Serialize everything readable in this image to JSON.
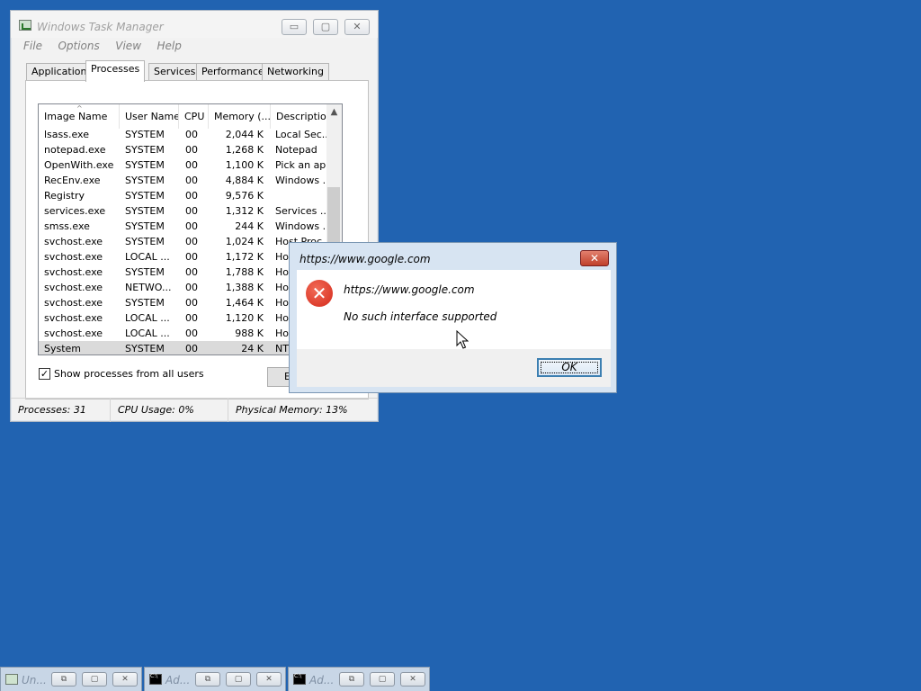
{
  "taskmgr": {
    "title": "Windows Task Manager",
    "caption_buttons": {
      "minimize": "▭",
      "restore": "▢",
      "close": "✕"
    },
    "menu": [
      "File",
      "Options",
      "View",
      "Help"
    ],
    "tabs": [
      "Applications",
      "Processes",
      "Services",
      "Performance",
      "Networking"
    ],
    "active_tab": "Processes",
    "columns": [
      "Image Name",
      "User Name",
      "CPU",
      "Memory (...",
      "Description"
    ],
    "rows": [
      {
        "name": "lsass.exe",
        "user": "SYSTEM",
        "cpu": "00",
        "mem": "2,044 K",
        "desc": "Local Sec..."
      },
      {
        "name": "notepad.exe",
        "user": "SYSTEM",
        "cpu": "00",
        "mem": "1,268 K",
        "desc": "Notepad"
      },
      {
        "name": "OpenWith.exe",
        "user": "SYSTEM",
        "cpu": "00",
        "mem": "1,100 K",
        "desc": "Pick an app"
      },
      {
        "name": "RecEnv.exe",
        "user": "SYSTEM",
        "cpu": "00",
        "mem": "4,884 K",
        "desc": "Windows ..."
      },
      {
        "name": "Registry",
        "user": "SYSTEM",
        "cpu": "00",
        "mem": "9,576 K",
        "desc": ""
      },
      {
        "name": "services.exe",
        "user": "SYSTEM",
        "cpu": "00",
        "mem": "1,312 K",
        "desc": "Services ..."
      },
      {
        "name": "smss.exe",
        "user": "SYSTEM",
        "cpu": "00",
        "mem": "244 K",
        "desc": "Windows ..."
      },
      {
        "name": "svchost.exe",
        "user": "SYSTEM",
        "cpu": "00",
        "mem": "1,024 K",
        "desc": "Host Proc..."
      },
      {
        "name": "svchost.exe",
        "user": "LOCAL ...",
        "cpu": "00",
        "mem": "1,172 K",
        "desc": "Host"
      },
      {
        "name": "svchost.exe",
        "user": "SYSTEM",
        "cpu": "00",
        "mem": "1,788 K",
        "desc": "Host"
      },
      {
        "name": "svchost.exe",
        "user": "NETWO...",
        "cpu": "00",
        "mem": "1,388 K",
        "desc": "Host"
      },
      {
        "name": "svchost.exe",
        "user": "SYSTEM",
        "cpu": "00",
        "mem": "1,464 K",
        "desc": "Host"
      },
      {
        "name": "svchost.exe",
        "user": "LOCAL ...",
        "cpu": "00",
        "mem": "1,120 K",
        "desc": "Host"
      },
      {
        "name": "svchost.exe",
        "user": "LOCAL ...",
        "cpu": "00",
        "mem": "988 K",
        "desc": "Host"
      },
      {
        "name": "System",
        "user": "SYSTEM",
        "cpu": "00",
        "mem": "24 K",
        "desc": "NT"
      }
    ],
    "selected_row": 14,
    "show_all_users": {
      "label": "Show processes from all users",
      "checked": true,
      "mark": "✓"
    },
    "end_button": "End Process",
    "status": {
      "processes": "Processes: 31",
      "cpu": "CPU Usage: 0%",
      "memory": "Physical Memory: 13%"
    }
  },
  "dialog": {
    "title": "https://www.google.com",
    "close_glyph": "✕",
    "icon_glyph": "✕",
    "message_title": "https://www.google.com",
    "message": "No such interface supported",
    "ok_label": "OK"
  },
  "minimized": [
    {
      "label": "Un...",
      "icon": "task-manager-icon"
    },
    {
      "label": "Ad...",
      "icon": "command-prompt-icon"
    },
    {
      "label": "Ad...",
      "icon": "command-prompt-icon"
    }
  ],
  "mini_buttons": {
    "restore": "⧉",
    "maximize": "▢",
    "close": "✕"
  },
  "colors": {
    "desktop": "#2163b1",
    "error_icon": "#d4291a",
    "dialog_close": "#c0402b",
    "selected_row": "#dadada"
  }
}
